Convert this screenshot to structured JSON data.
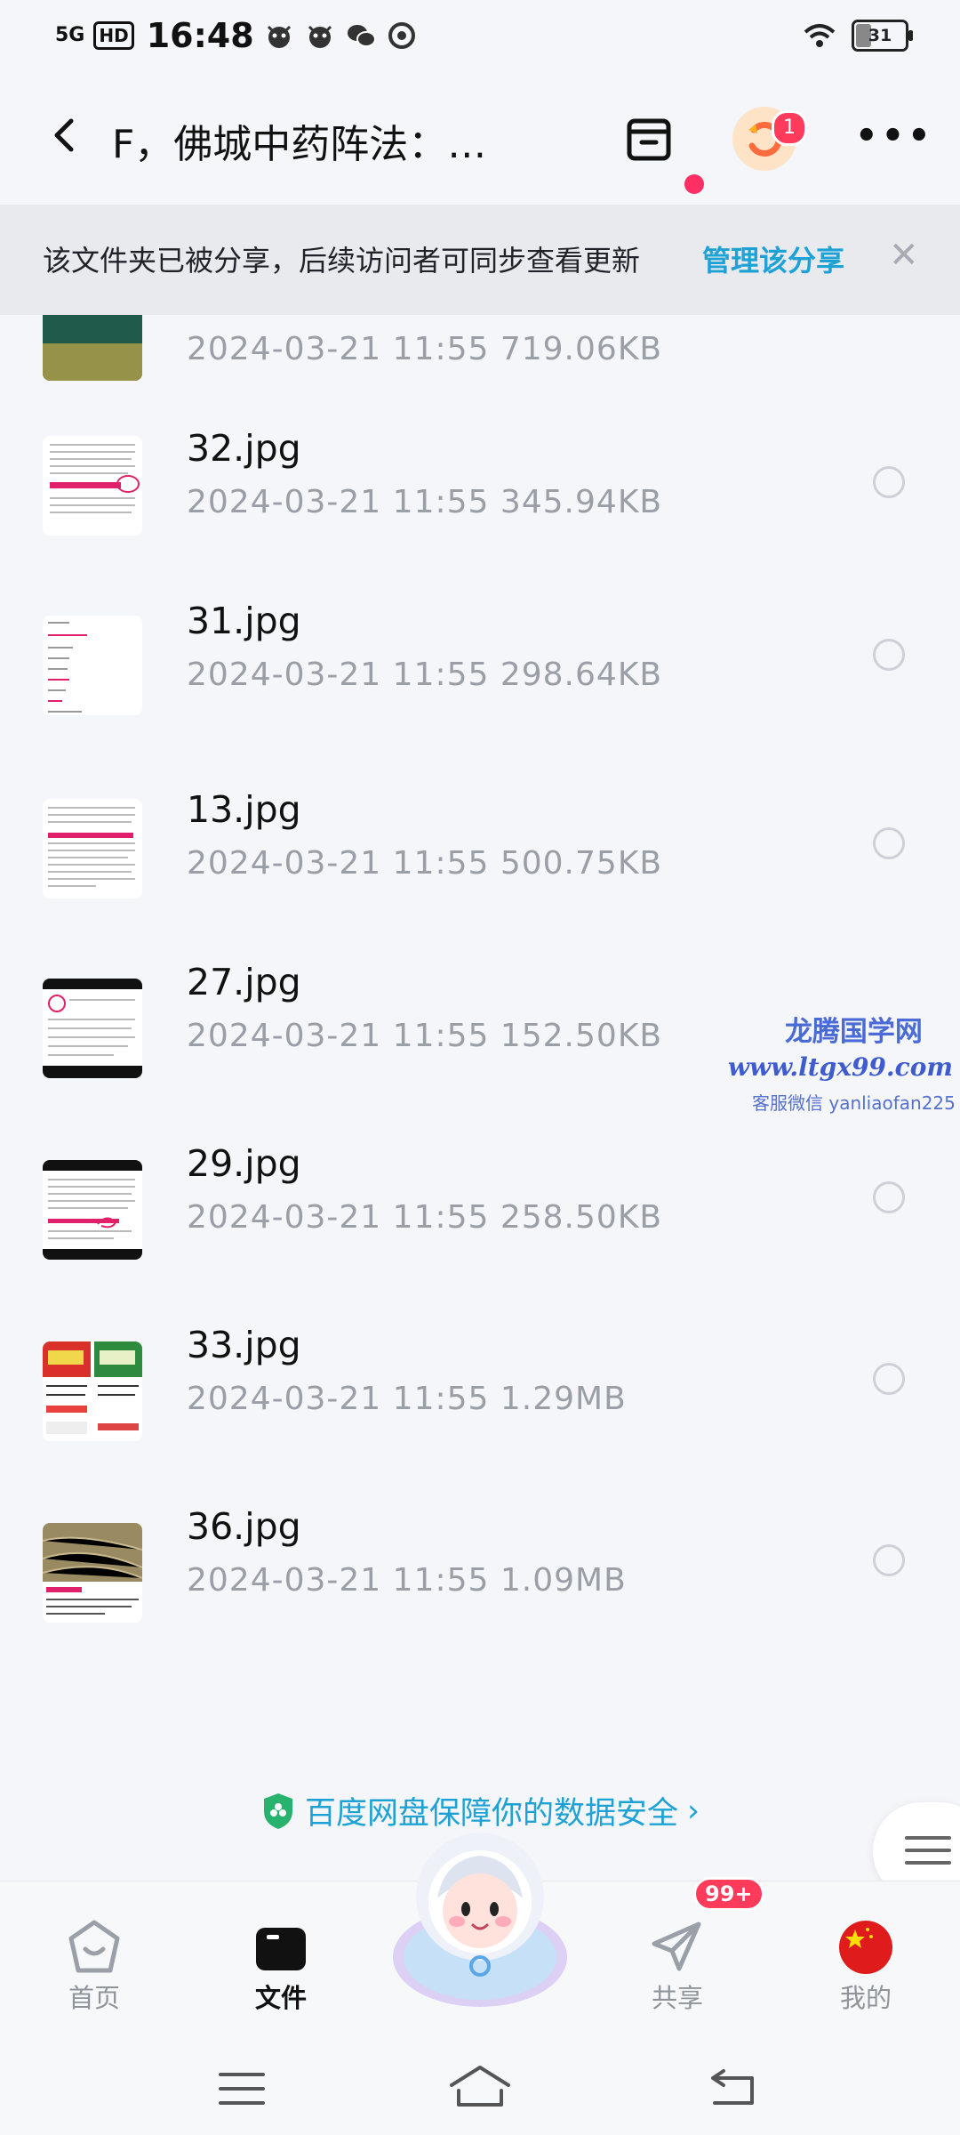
{
  "status_bar": {
    "signal": "5G",
    "hd": "HD",
    "time": "16:48",
    "battery": "31",
    "battery_level_percent": 31
  },
  "header": {
    "title": "F，佛城中药阵法：…",
    "avatar_badge": "1"
  },
  "banner": {
    "text": "该文件夹已被分享，后续访问者可同步查看更新",
    "link": "管理该分享",
    "close": "✕"
  },
  "files": [
    {
      "name": "",
      "meta": "2024-03-21  11:55  719.06KB"
    },
    {
      "name": "32.jpg",
      "meta": "2024-03-21  11:55  345.94KB"
    },
    {
      "name": "31.jpg",
      "meta": "2024-03-21  11:55  298.64KB"
    },
    {
      "name": "13.jpg",
      "meta": "2024-03-21  11:55  500.75KB"
    },
    {
      "name": "27.jpg",
      "meta": "2024-03-21  11:55  152.50KB"
    },
    {
      "name": "29.jpg",
      "meta": "2024-03-21  11:55  258.50KB"
    },
    {
      "name": "33.jpg",
      "meta": "2024-03-21  11:55  1.29MB"
    },
    {
      "name": "36.jpg",
      "meta": "2024-03-21  11:55  1.09MB"
    }
  ],
  "watermark": {
    "line1": "龙腾国学网",
    "line2": "www.ltgx99.com",
    "line3": "客服微信 yanliaofan225"
  },
  "security": {
    "text": "百度网盘保障你的数据安全",
    "chevron": "›"
  },
  "tabs": {
    "home": "首页",
    "files": "文件",
    "share": "共享",
    "mine": "我的",
    "share_badge": "99+"
  },
  "colors": {
    "accent": "#1ea2d6",
    "badge": "#ff3b5c",
    "background": "#f5f6f9"
  }
}
